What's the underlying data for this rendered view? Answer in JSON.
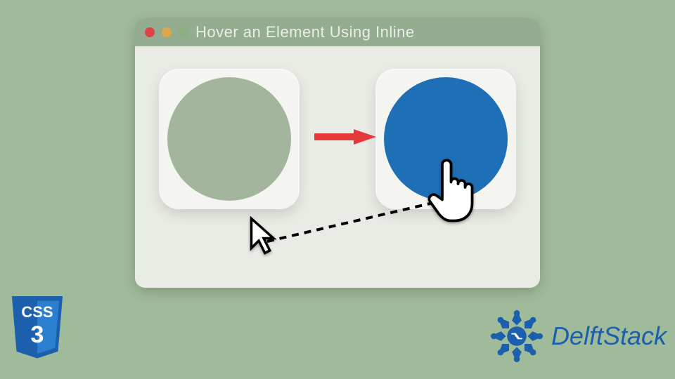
{
  "window": {
    "title": "Hover an Element Using Inline"
  },
  "colors": {
    "circle_default": "#a3b59d",
    "circle_hover": "#1f6fb6",
    "arrow": "#e53939",
    "background": "#a0bb9a"
  },
  "badges": {
    "css_label": "CSS",
    "css_version": "3",
    "brand": "DelftStack"
  }
}
